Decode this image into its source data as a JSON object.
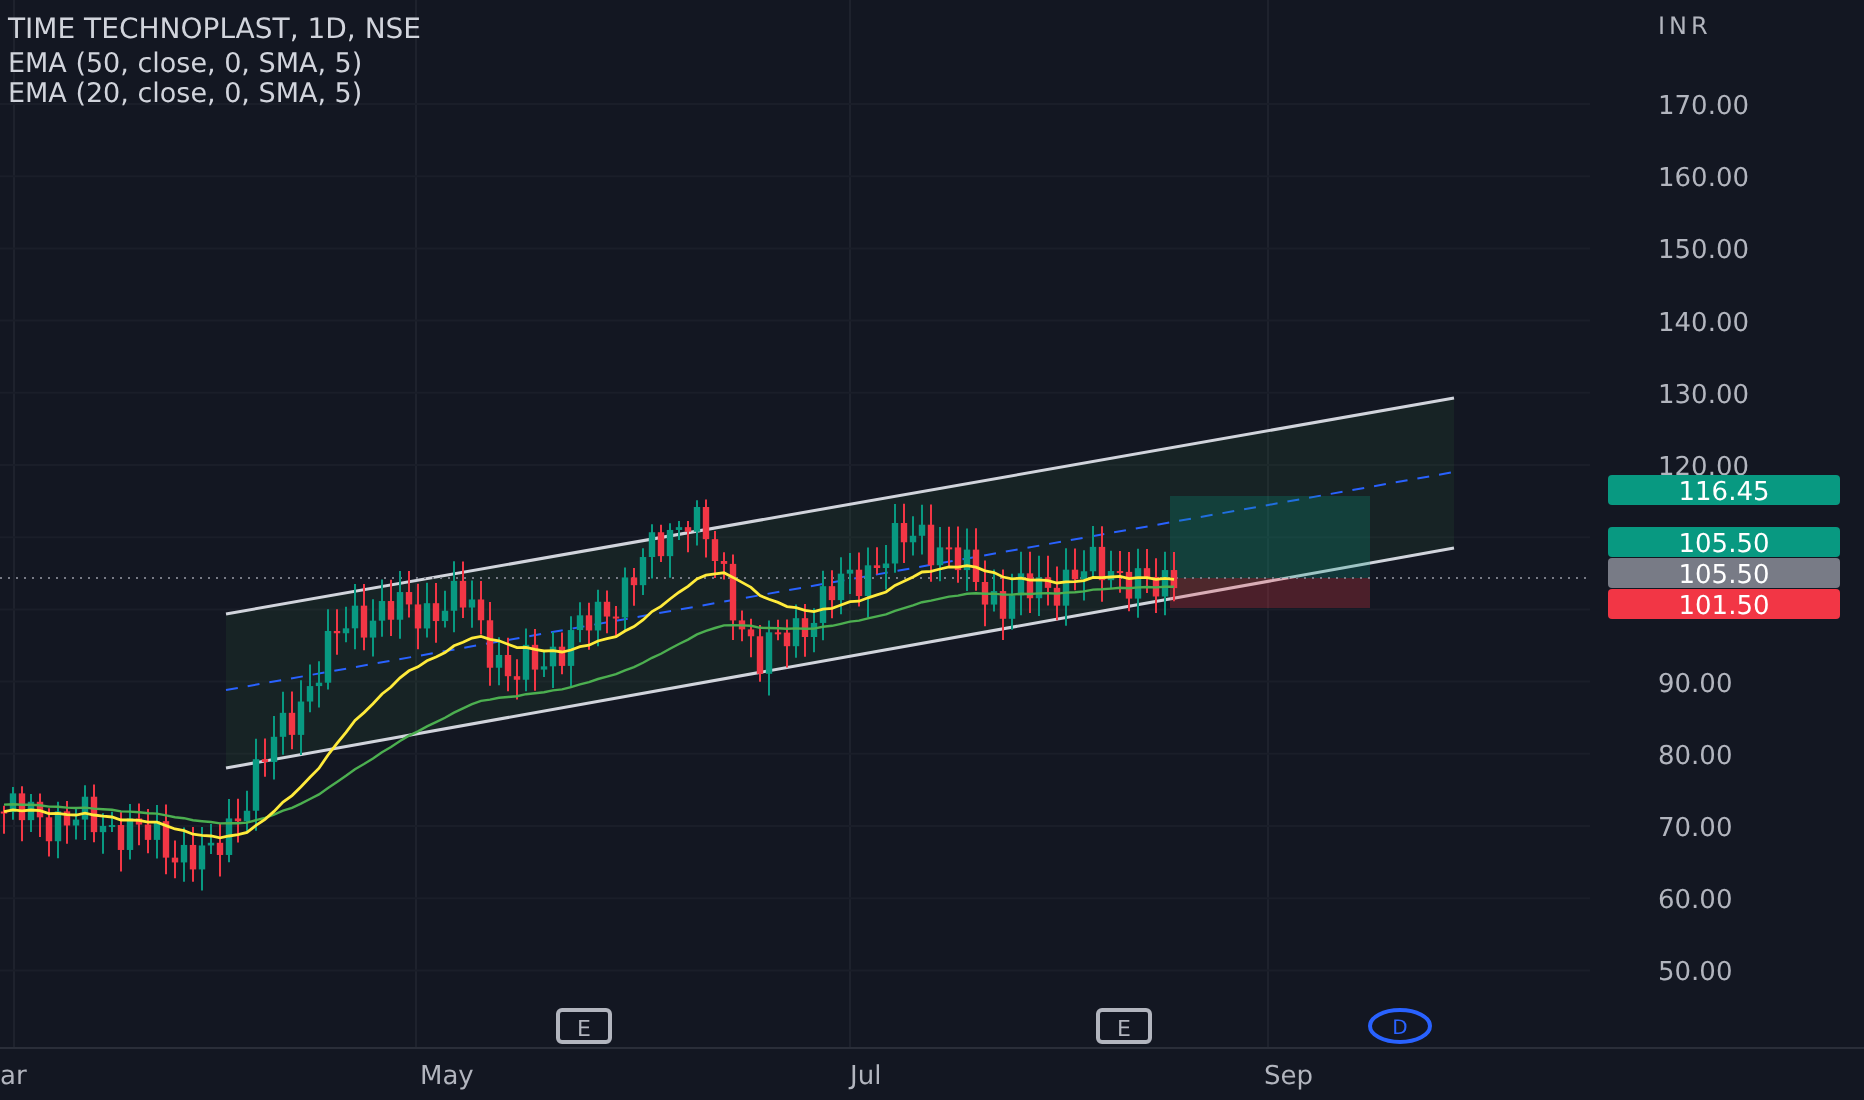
{
  "legend": {
    "title": "TIME TECHNOPLAST, 1D, NSE",
    "indicators": [
      "EMA (50, close, 0, SMA, 5)",
      "EMA (20, close, 0, SMA, 5)"
    ]
  },
  "price_axis": {
    "currency": "INR",
    "labels": [
      "170.00",
      "160.00",
      "150.00",
      "140.00",
      "130.00",
      "120.00",
      "90.00",
      "80.00",
      "70.00",
      "60.00",
      "50.00"
    ]
  },
  "price_tags": [
    {
      "text": "116.45",
      "color": "#089981"
    },
    {
      "text": "105.50",
      "color": "#089981"
    },
    {
      "text": "105.50",
      "color": "#787b86"
    },
    {
      "text": "101.50",
      "color": "#f23645"
    }
  ],
  "time_axis": {
    "labels": [
      "ar",
      "May",
      "Jul",
      "Sep"
    ]
  },
  "event_markers": [
    {
      "label": "E",
      "kind": "earnings"
    },
    {
      "label": "E",
      "kind": "earnings"
    },
    {
      "label": "D",
      "kind": "dividend"
    }
  ]
}
